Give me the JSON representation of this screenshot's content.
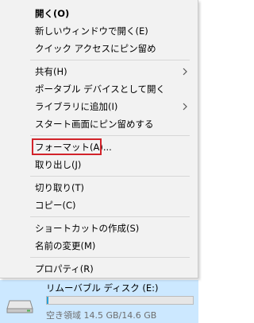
{
  "colors": {
    "menu_background": "#f2f2f2",
    "highlight_border": "#d2232a",
    "drive_selection": "#cce8ff",
    "drive_bar_fill": "#26a0da"
  },
  "context_menu": {
    "groups": [
      {
        "items": [
          {
            "label": "開く(O)",
            "bold": true,
            "submenu": false
          },
          {
            "label": "新しいウィンドウで開く(E)",
            "submenu": false
          },
          {
            "label": "クイック アクセスにピン留め",
            "submenu": false
          }
        ]
      },
      {
        "items": [
          {
            "label": "共有(H)",
            "submenu": true
          },
          {
            "label": "ポータブル デバイスとして開く",
            "submenu": false
          },
          {
            "label": "ライブラリに追加(I)",
            "submenu": true
          },
          {
            "label": "スタート画面にピン留めする",
            "submenu": false
          }
        ]
      },
      {
        "items": [
          {
            "label": "フォーマット(A)...",
            "submenu": false,
            "highlighted": true
          },
          {
            "label": "取り出し(J)",
            "submenu": false
          }
        ]
      },
      {
        "items": [
          {
            "label": "切り取り(T)",
            "submenu": false
          },
          {
            "label": "コピー(C)",
            "submenu": false
          }
        ]
      },
      {
        "items": [
          {
            "label": "ショートカットの作成(S)",
            "submenu": false
          },
          {
            "label": "名前の変更(M)",
            "submenu": false
          }
        ]
      },
      {
        "items": [
          {
            "label": "プロパティ(R)",
            "submenu": false
          }
        ]
      }
    ]
  },
  "drive": {
    "name": "リムーバブル ディスク (E:)",
    "free_space_text": "空き領域 14.5 GB/14.6 GB",
    "used_fraction": 0.007,
    "icon": "removable-drive-icon"
  }
}
